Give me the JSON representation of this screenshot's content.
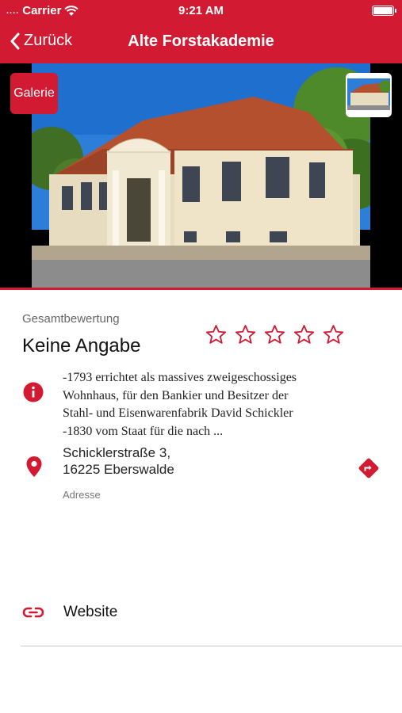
{
  "status_bar": {
    "carrier": "Carrier",
    "time": "9:21 AM",
    "icons": [
      "signal-dots-icon",
      "wifi-icon",
      "battery-icon"
    ]
  },
  "nav": {
    "back_label": "Zurück",
    "title": "Alte Forstakademie"
  },
  "hero": {
    "gallery_label": "Galerie",
    "photo": "building-photo"
  },
  "rating": {
    "label": "Gesamtbewertung",
    "value": "Keine Angabe",
    "stars_filled": 0,
    "stars_total": 5
  },
  "info": {
    "description": [
      "-1793 errichtet als massives zweigeschossiges",
      "Wohnhaus, für den Bankier und Besitzer der",
      "Stahl- und Eisenwarenfabrik David Schickler",
      "-1830 vom Staat für die nach ..."
    ]
  },
  "address": {
    "street": "Schicklerstraße 3,",
    "city": "16225 Eberswalde",
    "label": "Adresse"
  },
  "website": {
    "label": "Website"
  },
  "colors": {
    "accent": "#d21a32",
    "text": "#111111",
    "muted": "#666666",
    "divider": "#c8c8c8"
  }
}
